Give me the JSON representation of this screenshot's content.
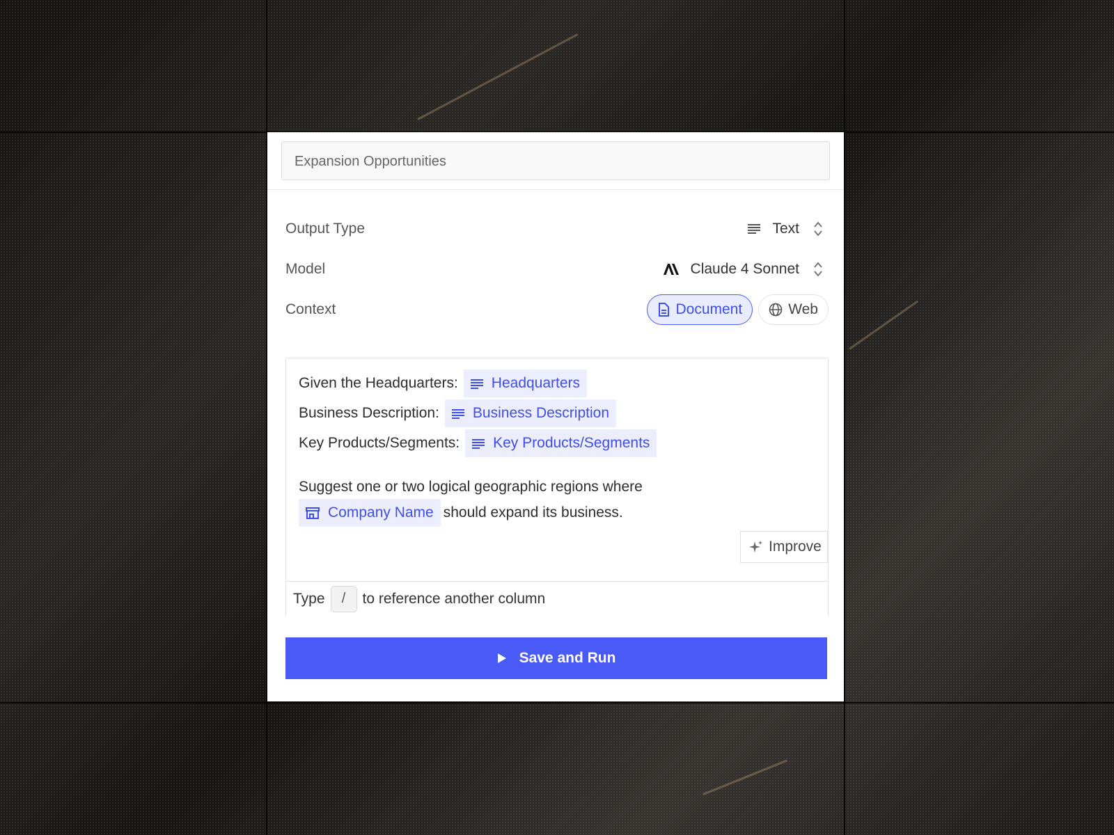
{
  "colors": {
    "accent": "#4a5af7",
    "chip_bg": "#eceefd",
    "chip_text": "#3f4ee8"
  },
  "column_title": "Expansion Opportunities",
  "settings": {
    "output_type": {
      "label": "Output Type",
      "value": "Text",
      "icon": "lines-icon"
    },
    "model": {
      "label": "Model",
      "value": "Claude 4 Sonnet",
      "icon": "anthropic-logo-icon"
    },
    "context": {
      "label": "Context",
      "options": [
        {
          "label": "Document",
          "icon": "document-icon",
          "active": true
        },
        {
          "label": "Web",
          "icon": "globe-icon",
          "active": false
        }
      ]
    }
  },
  "prompt": {
    "line1_text": "Given the Headquarters:",
    "line1_chip": "Headquarters",
    "line2_text": "Business Description:",
    "line2_chip": "Business Description",
    "line3_text": "Key Products/Segments:",
    "line3_chip": "Key Products/Segments",
    "line4_text": "Suggest one or two logical geographic regions where",
    "line5_chip": "Company Name",
    "line5_text": "should expand its business."
  },
  "improve_label": "Improve",
  "hint": {
    "before": "Type",
    "key": "/",
    "after": "to reference another column"
  },
  "run_button_label": "Save and Run"
}
